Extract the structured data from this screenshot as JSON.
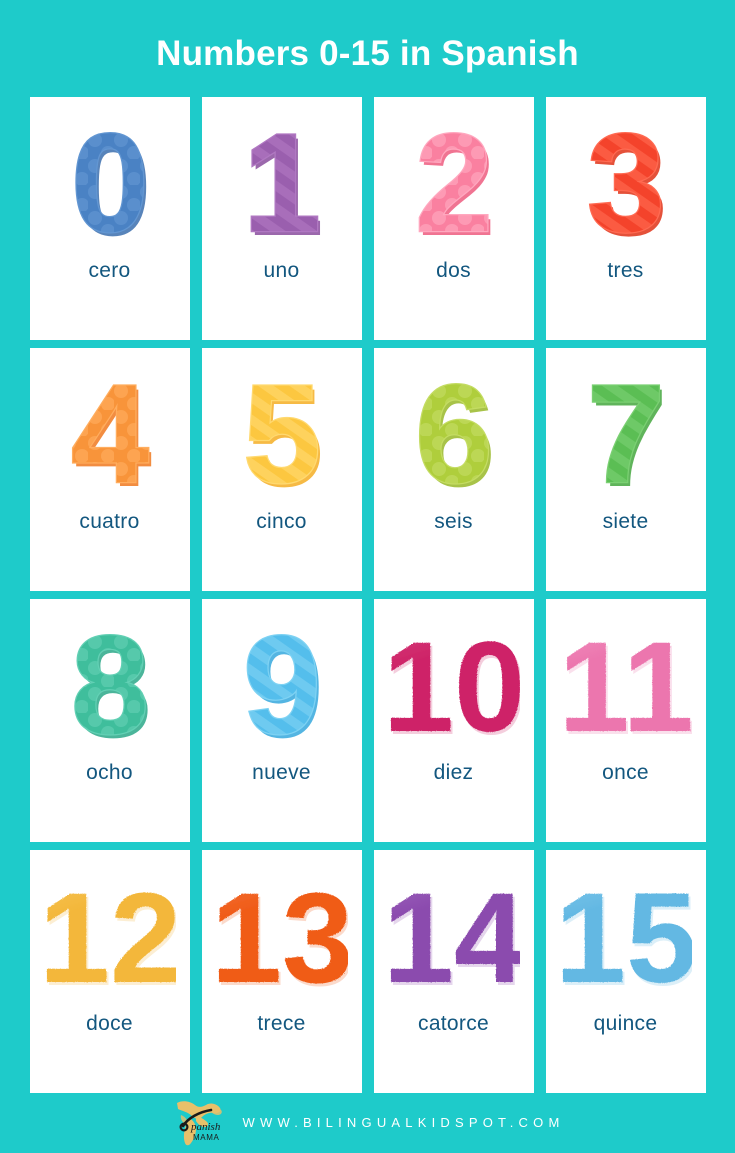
{
  "header": {
    "title": "Numbers 0-15 in Spanish",
    "bg_color": "#1ECBCA",
    "title_color": "#FFFFFF"
  },
  "card_style": {
    "bg_color": "#FFFFFF",
    "label_color": "#13577F"
  },
  "cards": [
    {
      "digit": "0",
      "label": "cero",
      "color": "#4A82C4",
      "shade": "#3C6FAE",
      "light": "#6296D2",
      "pattern": "dots",
      "style": "cartoon"
    },
    {
      "digit": "1",
      "label": "uno",
      "color": "#9A5FAE",
      "shade": "#8A4E9E",
      "light": "#B078C2",
      "pattern": "stripes",
      "style": "cartoon"
    },
    {
      "digit": "2",
      "label": "dos",
      "color": "#F craftsmanship",
      "shade": "#EE5C80",
      "light": "#FFA8BF",
      "pattern": "dots",
      "style": "cartoon"
    },
    {
      "digit": "3",
      "label": "tres",
      "color": "#F4432B",
      "shade": "#E03318",
      "light": "#FF6A52",
      "pattern": "stripes",
      "style": "cartoon"
    },
    {
      "digit": "4",
      "label": "cuatro",
      "color": "#F8943A",
      "shade": "#F07A20",
      "light": "#FFAD5E",
      "pattern": "dots",
      "style": "cartoon"
    },
    {
      "digit": "5",
      "label": "cinco",
      "color": "#FCC740",
      "shade": "#F5AF25",
      "light": "#FFD970",
      "pattern": "stripes",
      "style": "cartoon"
    },
    {
      "digit": "6",
      "label": "seis",
      "color": "#AFCE3C",
      "shade": "#99B92A",
      "light": "#C4DC63",
      "pattern": "dots",
      "style": "cartoon"
    },
    {
      "digit": "7",
      "label": "siete",
      "color": "#5BBE54",
      "shade": "#45A83F",
      "light": "#7BD073",
      "pattern": "stripes",
      "style": "cartoon"
    },
    {
      "digit": "8",
      "label": "ocho",
      "color": "#3FBE9C",
      "shade": "#2CA989",
      "light": "#62D0B4",
      "pattern": "dots",
      "style": "cartoon"
    },
    {
      "digit": "9",
      "label": "nueve",
      "color": "#54BEEC",
      "shade": "#37A9DD",
      "light": "#7ED2F3",
      "pattern": "stripes",
      "style": "cartoon"
    },
    {
      "digit": "10",
      "label": "diez",
      "color": "#CE2468",
      "shade": "#CE2468",
      "light": "#D9447F",
      "pattern": "texture",
      "style": "watercolor"
    },
    {
      "digit": "11",
      "label": "once",
      "color": "#EC76AE",
      "shade": "#EC76AE",
      "light": "#F294C2",
      "pattern": "texture",
      "style": "watercolor"
    },
    {
      "digit": "12",
      "label": "doce",
      "color": "#F3B73A",
      "shade": "#F3B73A",
      "light": "#F7C860",
      "pattern": "texture",
      "style": "watercolor"
    },
    {
      "digit": "13",
      "label": "trece",
      "color": "#F05B18",
      "shade": "#F05B18",
      "light": "#F47A3E",
      "pattern": "texture",
      "style": "watercolor"
    },
    {
      "digit": "14",
      "label": "catorce",
      "color": "#8B4BAE",
      "shade": "#8B4BAE",
      "light": "#A268C0",
      "pattern": "texture",
      "style": "watercolor"
    },
    {
      "digit": "15",
      "label": "quince",
      "color": "#63B8E3",
      "shade": "#63B8E3",
      "light": "#85CAEC",
      "pattern": "texture",
      "style": "watercolor"
    }
  ],
  "footer": {
    "url": "WWW.BILINGUALKIDSPOT.COM",
    "logo_primary": "Spanish",
    "logo_secondary": "MAMA",
    "logo_color": "#E8C06A",
    "url_color": "#FFFFFF"
  }
}
